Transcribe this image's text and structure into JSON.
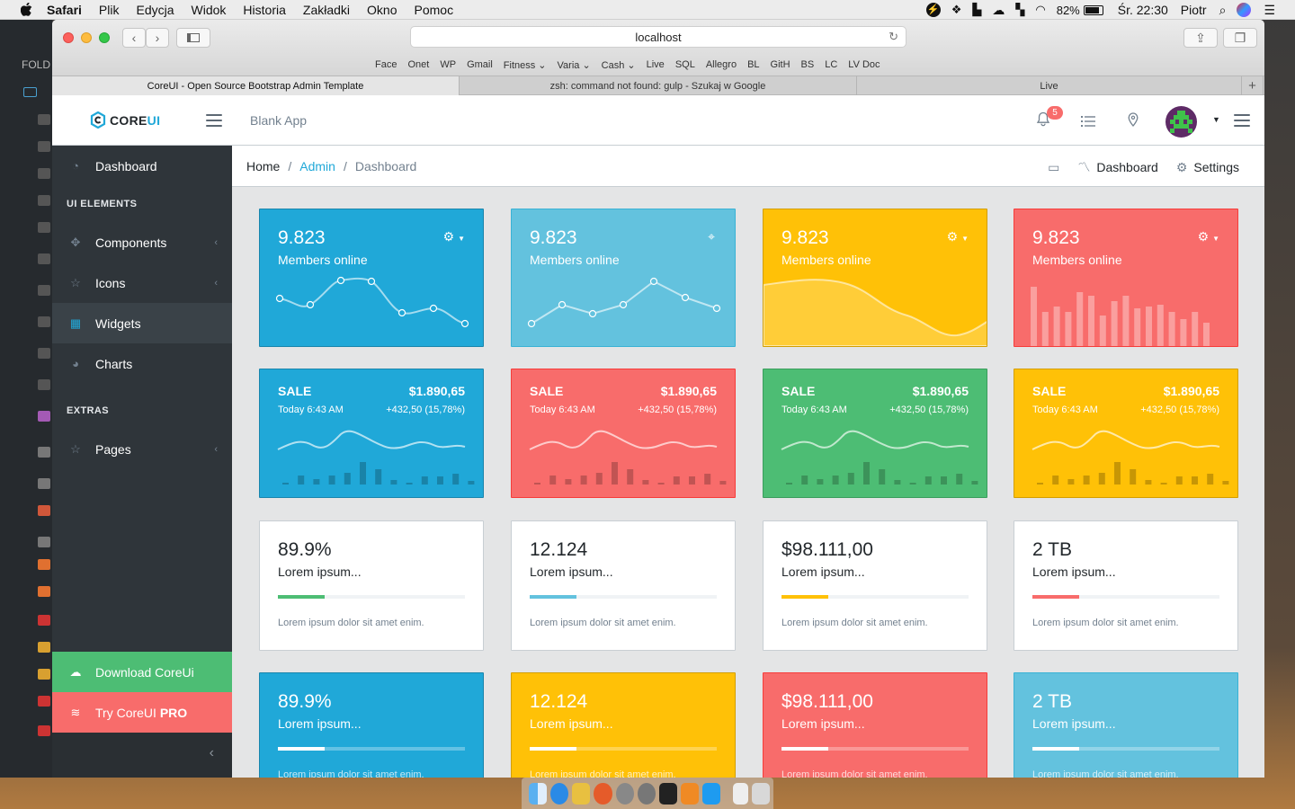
{
  "menubar": {
    "items": [
      "Safari",
      "Plik",
      "Edycja",
      "Widok",
      "Historia",
      "Zakładki",
      "Okno",
      "Pomoc"
    ],
    "battery": "82%",
    "clock": "Śr. 22:30",
    "user": "Piotr"
  },
  "desktop": {
    "folder_label": "FOLD"
  },
  "browser": {
    "url": "localhost",
    "favorites": [
      "Face",
      "Onet",
      "WP",
      "Gmail",
      "Fitness ⌄",
      "Varia ⌄",
      "Cash ⌄",
      "Live",
      "SQL",
      "Allegro",
      "BL",
      "GitH",
      "BS",
      "LC",
      "LV Doc"
    ],
    "tabs": [
      {
        "title": "CoreUI - Open Source Bootstrap Admin Template",
        "active": true
      },
      {
        "title": "zsh: command not found: gulp - Szukaj w Google",
        "active": false
      },
      {
        "title": "Live",
        "active": false
      }
    ]
  },
  "header": {
    "logo_core": "CORE",
    "logo_ui": "UI",
    "app_name": "Blank App",
    "notification_count": "5"
  },
  "sidebar": {
    "dashboard": "Dashboard",
    "section_ui": "UI ELEMENTS",
    "components": "Components",
    "icons": "Icons",
    "widgets": "Widgets",
    "charts": "Charts",
    "section_extras": "EXTRAS",
    "pages": "Pages",
    "download": "Download CoreUi",
    "try_pro_prefix": "Try CoreUI ",
    "try_pro_bold": "PRO"
  },
  "breadcrumb": {
    "home": "Home",
    "admin": "Admin",
    "current": "Dashboard",
    "right_dashboard": "Dashboard",
    "right_settings": "Settings"
  },
  "colors": {
    "primary": "#20a8d8",
    "info": "#63c2de",
    "warning": "#ffc107",
    "danger": "#f86c6b",
    "success": "#4dbd74"
  },
  "row1": [
    {
      "value": "9.823",
      "label": "Members online",
      "icon": "gear-icon",
      "color": "#20a8d8",
      "chart": "line"
    },
    {
      "value": "9.823",
      "label": "Members online",
      "icon": "location-pin-icon",
      "color": "#63c2de",
      "chart": "line"
    },
    {
      "value": "9.823",
      "label": "Members online",
      "icon": "gear-icon",
      "color": "#ffc107",
      "chart": "area"
    },
    {
      "value": "9.823",
      "label": "Members online",
      "icon": "gear-icon",
      "color": "#f86c6b",
      "chart": "bar"
    }
  ],
  "row2": [
    {
      "label": "SALE",
      "amount": "$1.890,65",
      "time": "Today 6:43 AM",
      "change": "+432,50 (15,78%)",
      "color": "#20a8d8"
    },
    {
      "label": "SALE",
      "amount": "$1.890,65",
      "time": "Today 6:43 AM",
      "change": "+432,50 (15,78%)",
      "color": "#f86c6b"
    },
    {
      "label": "SALE",
      "amount": "$1.890,65",
      "time": "Today 6:43 AM",
      "change": "+432,50 (15,78%)",
      "color": "#4dbd74"
    },
    {
      "label": "SALE",
      "amount": "$1.890,65",
      "time": "Today 6:43 AM",
      "change": "+432,50 (15,78%)",
      "color": "#ffc107"
    }
  ],
  "row3": [
    {
      "value": "89.9%",
      "label": "Lorem ipsum...",
      "desc": "Lorem ipsum dolor sit amet enim.",
      "progress": 0.25,
      "color": "#4dbd74"
    },
    {
      "value": "12.124",
      "label": "Lorem ipsum...",
      "desc": "Lorem ipsum dolor sit amet enim.",
      "progress": 0.25,
      "color": "#63c2de"
    },
    {
      "value": "$98.111,00",
      "label": "Lorem ipsum...",
      "desc": "Lorem ipsum dolor sit amet enim.",
      "progress": 0.25,
      "color": "#ffc107"
    },
    {
      "value": "2 TB",
      "label": "Lorem ipsum...",
      "desc": "Lorem ipsum dolor sit amet enim.",
      "progress": 0.25,
      "color": "#f86c6b"
    }
  ],
  "row4": [
    {
      "value": "89.9%",
      "label": "Lorem ipsum...",
      "desc": "Lorem ipsum dolor sit amet enim.",
      "progress": 0.25,
      "color": "#20a8d8"
    },
    {
      "value": "12.124",
      "label": "Lorem ipsum...",
      "desc": "Lorem ipsum dolor sit amet enim.",
      "progress": 0.25,
      "color": "#ffc107"
    },
    {
      "value": "$98.111,00",
      "label": "Lorem ipsum...",
      "desc": "Lorem ipsum dolor sit amet enim.",
      "progress": 0.25,
      "color": "#f86c6b"
    },
    {
      "value": "2 TB",
      "label": "Lorem ipsum...",
      "desc": "Lorem ipsum dolor sit amet enim.",
      "progress": 0.25,
      "color": "#63c2de"
    }
  ]
}
